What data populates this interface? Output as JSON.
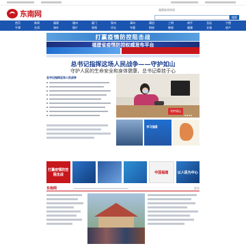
{
  "header": {
    "logo_text": "东南网",
    "hotline": "福建新闻热线",
    "search_placeholder": "",
    "search_button": "搜索"
  },
  "nav": {
    "items": [
      "首页",
      "新闻",
      "福建",
      "福州",
      "厦门",
      "泉州",
      "漳州",
      "莆田",
      "三明",
      "南平",
      "龙岩",
      "宁德",
      "平潭",
      "台湾",
      "海外",
      "图片",
      "视频",
      "评论",
      "专题",
      "财经",
      "教育",
      "健康",
      "文旅",
      "房产"
    ]
  },
  "banners": {
    "b1": "打赢疫情防控阻击战",
    "b2": "福建省疫情防控权威发布平台",
    "b4": "",
    "b5": ""
  },
  "main": {
    "headline": "总书记指挥这场人民战争——守护如山",
    "subhead": "守护人民的生命安全和身体健康，总书记牵挂于心",
    "left_news_title": "总书记指挥这场人民战争",
    "photo_plaque": "守护如山"
  },
  "thumbs": {
    "t2_label": "学习强国"
  },
  "tiles": [
    "打赢疫情防控阻击战",
    "",
    "",
    "",
    "中国福建",
    "以人民为中心"
  ],
  "section": {
    "tag": "东南网",
    "more": "更多"
  },
  "colors": {
    "brand_red": "#c8161d",
    "nav_blue": "#1b55b0",
    "headline_blue": "#1a3e8e"
  }
}
